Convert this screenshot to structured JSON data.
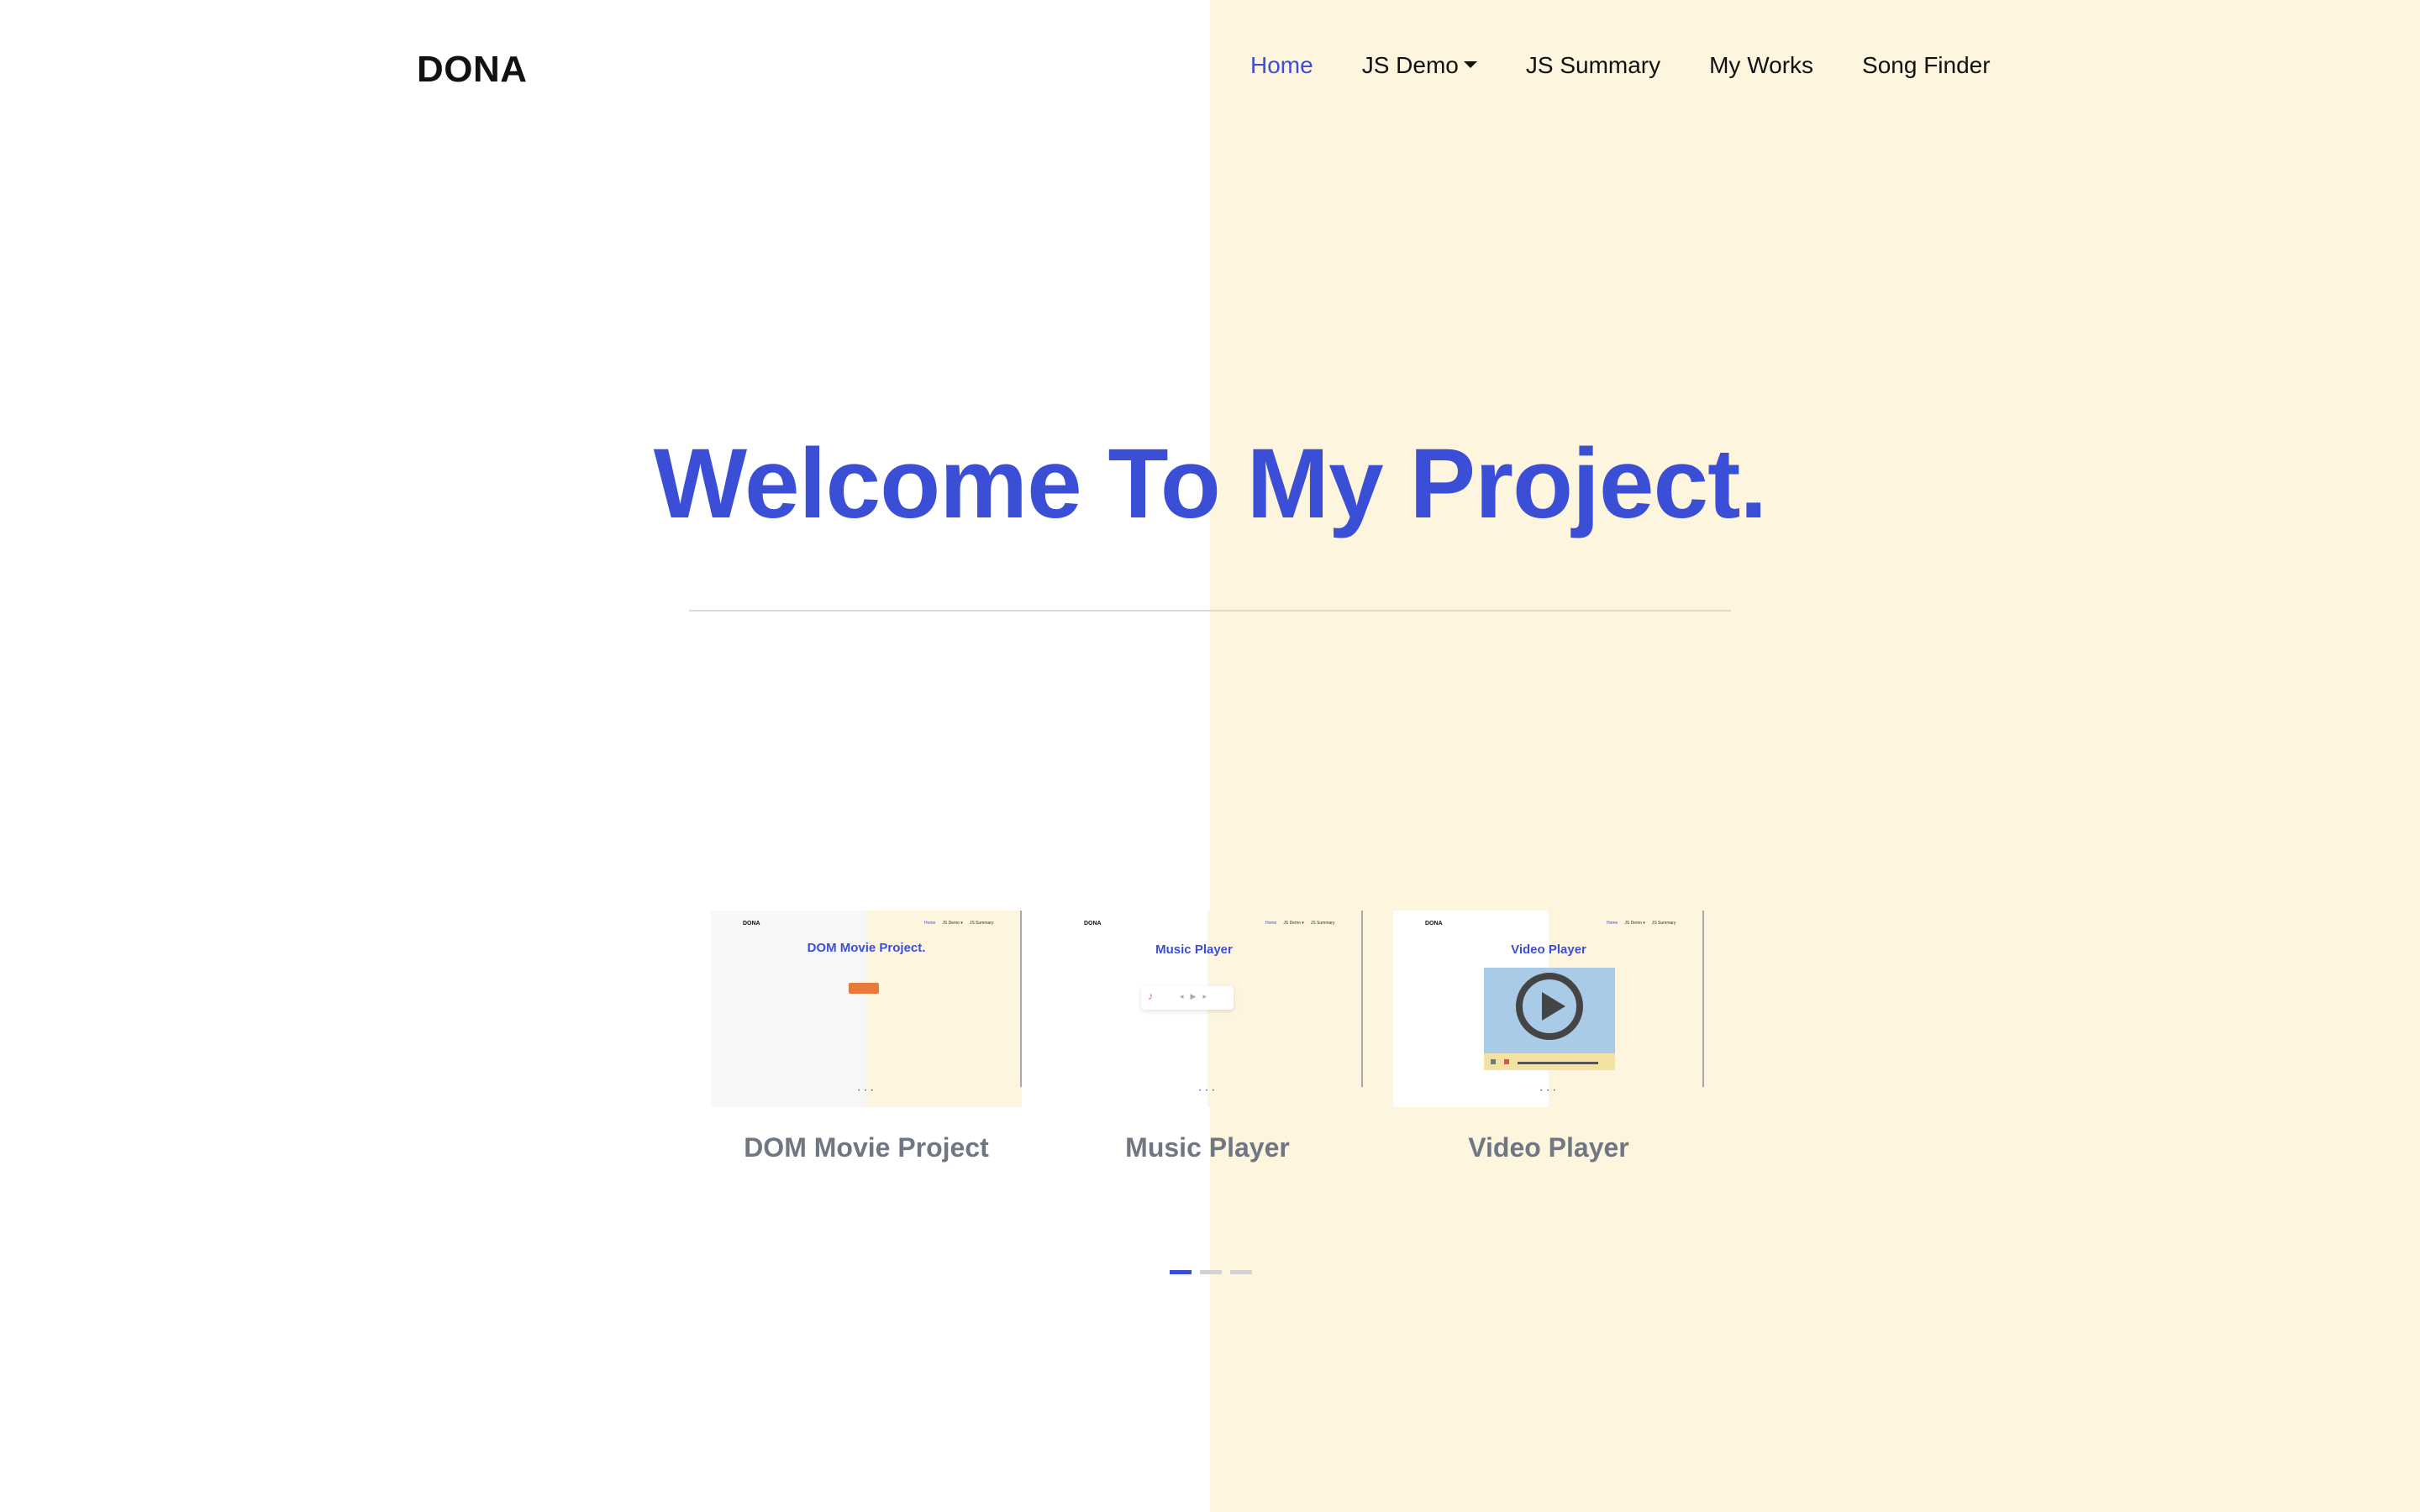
{
  "brand": {
    "logo": "DONA"
  },
  "nav": {
    "items": [
      {
        "label": "Home",
        "active": true
      },
      {
        "label": "JS Demo",
        "dropdown": true
      },
      {
        "label": "JS Summary"
      },
      {
        "label": "My Works"
      },
      {
        "label": "Song Finder"
      }
    ]
  },
  "hero": {
    "title": "Welcome To My Project."
  },
  "carousel": {
    "cards": [
      {
        "label": "DOM Movie Project",
        "thumb": {
          "logo": "DONA",
          "nav": [
            "Home",
            "JS Demo ▾",
            "JS Summary"
          ],
          "title": "DOM Movie Project."
        }
      },
      {
        "label": "Music Player",
        "thumb": {
          "logo": "DONA",
          "nav": [
            "Home",
            "JS Demo ▾",
            "JS Summary"
          ],
          "title": "Music Player",
          "art_icon": "music-art-icon"
        }
      },
      {
        "label": "Video Player",
        "thumb": {
          "logo": "DONA",
          "nav": [
            "Home",
            "JS Demo ▾",
            "JS Summary"
          ],
          "title": "Video Player",
          "play_icon": "play-icon"
        }
      }
    ],
    "active_indicator": 0,
    "indicator_count": 3
  },
  "colors": {
    "accent": "#3b4fd6",
    "right_background": "#fdf5de",
    "card_label": "#6f7782"
  }
}
